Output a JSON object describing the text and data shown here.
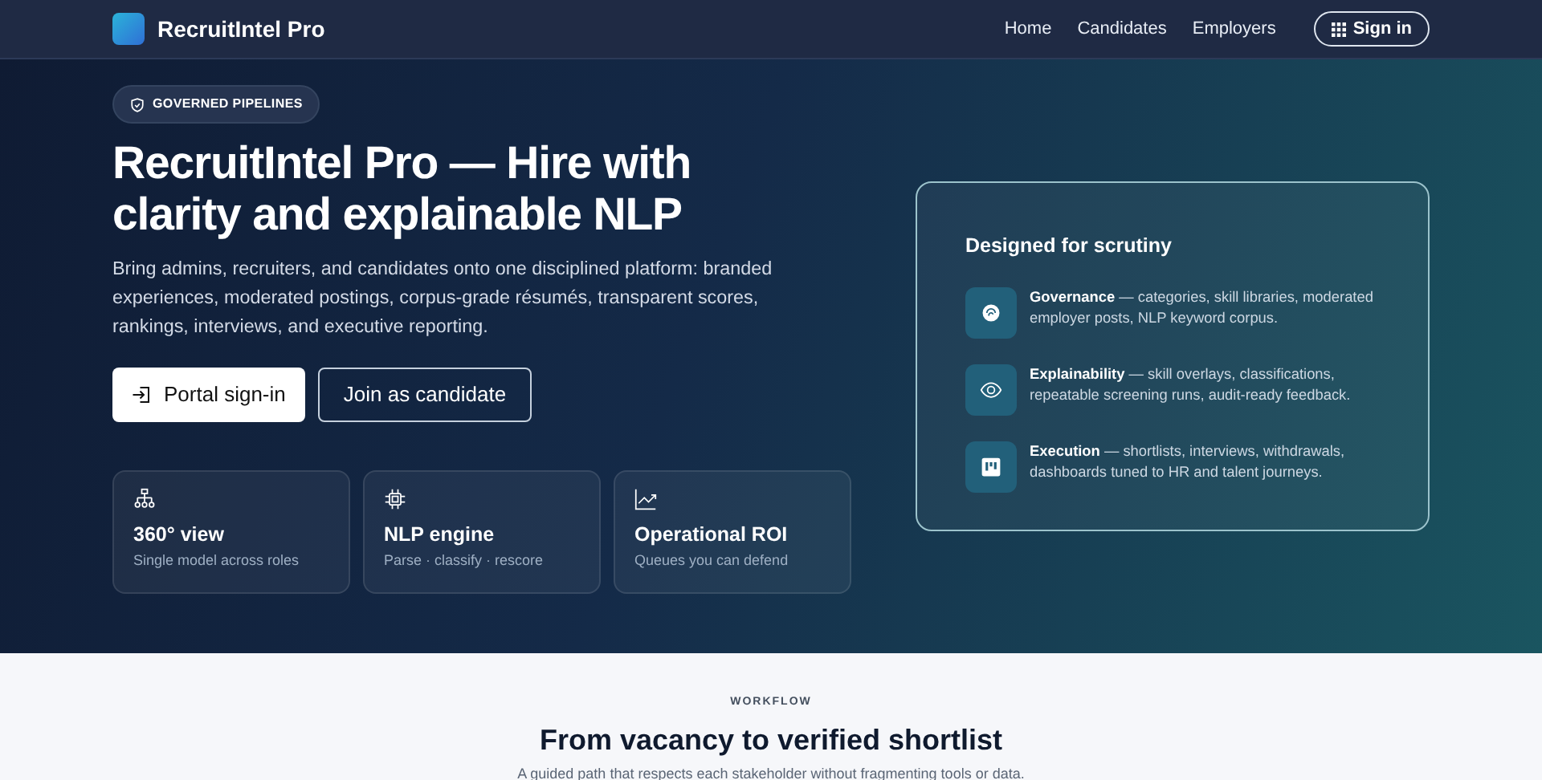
{
  "navbar": {
    "brand": "RecruitIntel Pro",
    "links": [
      {
        "label": "Home"
      },
      {
        "label": "Candidates"
      },
      {
        "label": "Employers"
      }
    ],
    "sign_in": "Sign in"
  },
  "hero": {
    "badge": "GOVERNED PIPELINES",
    "title": "RecruitIntel Pro — Hire with clarity and explainable NLP",
    "lead": "Bring admins, recruiters, and candidates onto one disciplined platform: branded experiences, moderated postings, corpus-grade résumés, transparent scores, rankings, interviews, and executive reporting.",
    "buttons": [
      {
        "label": "Portal sign-in",
        "kind": "primary"
      },
      {
        "label": "Join as candidate",
        "kind": "outline"
      }
    ],
    "stats": [
      {
        "title": "360° view",
        "subtitle": "Single model across roles"
      },
      {
        "title": "NLP engine",
        "subtitle": "Parse · classify · rescore"
      },
      {
        "title": "Operational ROI",
        "subtitle": "Queues you can defend"
      }
    ]
  },
  "panel": {
    "title": "Designed for scrutiny",
    "items": [
      {
        "text": "**Governance** — categories, skill libraries, moderated employer posts, NLP keyword corpus."
      },
      {
        "text": "**Explainability** — skill overlays, classifications, repeatable screening runs, audit-ready feedback."
      },
      {
        "text": "**Execution** — shortlists, interviews, withdrawals, dashboards tuned to HR and talent journeys."
      }
    ]
  },
  "workflow": {
    "eyebrow": "WORKFLOW",
    "title": "From vacancy to verified shortlist",
    "subtitle": "A guided path that respects each stakeholder without fragmenting tools or data."
  }
}
